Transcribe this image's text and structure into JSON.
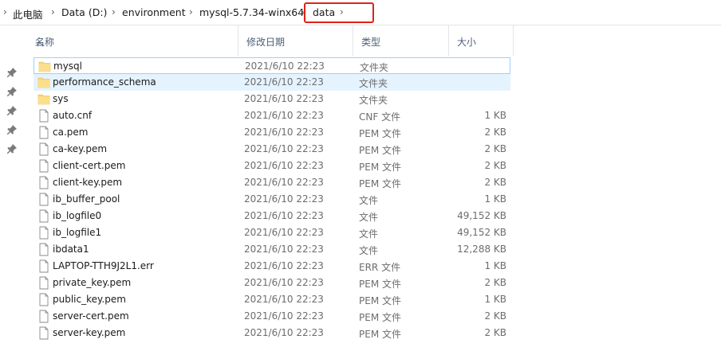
{
  "breadcrumb": {
    "items": [
      "此电脑",
      "Data (D:)",
      "environment",
      "mysql-5.7.34-winx64",
      "data"
    ]
  },
  "columns": {
    "name": "名称",
    "date": "修改日期",
    "type": "类型",
    "size": "大小"
  },
  "files": [
    {
      "name": "mysql",
      "date": "2021/6/10 22:23",
      "type": "文件夹",
      "size": "",
      "icon": "folder-icon"
    },
    {
      "name": "performance_schema",
      "date": "2021/6/10 22:23",
      "type": "文件夹",
      "size": "",
      "icon": "folder-icon"
    },
    {
      "name": "sys",
      "date": "2021/6/10 22:23",
      "type": "文件夹",
      "size": "",
      "icon": "folder-icon"
    },
    {
      "name": "auto.cnf",
      "date": "2021/6/10 22:23",
      "type": "CNF 文件",
      "size": "1 KB",
      "icon": "file-icon"
    },
    {
      "name": "ca.pem",
      "date": "2021/6/10 22:23",
      "type": "PEM 文件",
      "size": "2 KB",
      "icon": "file-icon"
    },
    {
      "name": "ca-key.pem",
      "date": "2021/6/10 22:23",
      "type": "PEM 文件",
      "size": "2 KB",
      "icon": "file-icon"
    },
    {
      "name": "client-cert.pem",
      "date": "2021/6/10 22:23",
      "type": "PEM 文件",
      "size": "2 KB",
      "icon": "file-icon"
    },
    {
      "name": "client-key.pem",
      "date": "2021/6/10 22:23",
      "type": "PEM 文件",
      "size": "2 KB",
      "icon": "file-icon"
    },
    {
      "name": "ib_buffer_pool",
      "date": "2021/6/10 22:23",
      "type": "文件",
      "size": "1 KB",
      "icon": "file-icon"
    },
    {
      "name": "ib_logfile0",
      "date": "2021/6/10 22:23",
      "type": "文件",
      "size": "49,152 KB",
      "icon": "file-icon"
    },
    {
      "name": "ib_logfile1",
      "date": "2021/6/10 22:23",
      "type": "文件",
      "size": "49,152 KB",
      "icon": "file-icon"
    },
    {
      "name": "ibdata1",
      "date": "2021/6/10 22:23",
      "type": "文件",
      "size": "12,288 KB",
      "icon": "file-icon"
    },
    {
      "name": "LAPTOP-TTH9J2L1.err",
      "date": "2021/6/10 22:23",
      "type": "ERR 文件",
      "size": "1 KB",
      "icon": "file-icon"
    },
    {
      "name": "private_key.pem",
      "date": "2021/6/10 22:23",
      "type": "PEM 文件",
      "size": "2 KB",
      "icon": "file-icon"
    },
    {
      "name": "public_key.pem",
      "date": "2021/6/10 22:23",
      "type": "PEM 文件",
      "size": "1 KB",
      "icon": "file-icon"
    },
    {
      "name": "server-cert.pem",
      "date": "2021/6/10 22:23",
      "type": "PEM 文件",
      "size": "2 KB",
      "icon": "file-icon"
    },
    {
      "name": "server-key.pem",
      "date": "2021/6/10 22:23",
      "type": "PEM 文件",
      "size": "2 KB",
      "icon": "file-icon"
    }
  ],
  "colors": {
    "highlight": "#e0221b",
    "folder": "#f8d775",
    "selection": "#e5f3ff",
    "selection_border": "#99d1ff"
  }
}
